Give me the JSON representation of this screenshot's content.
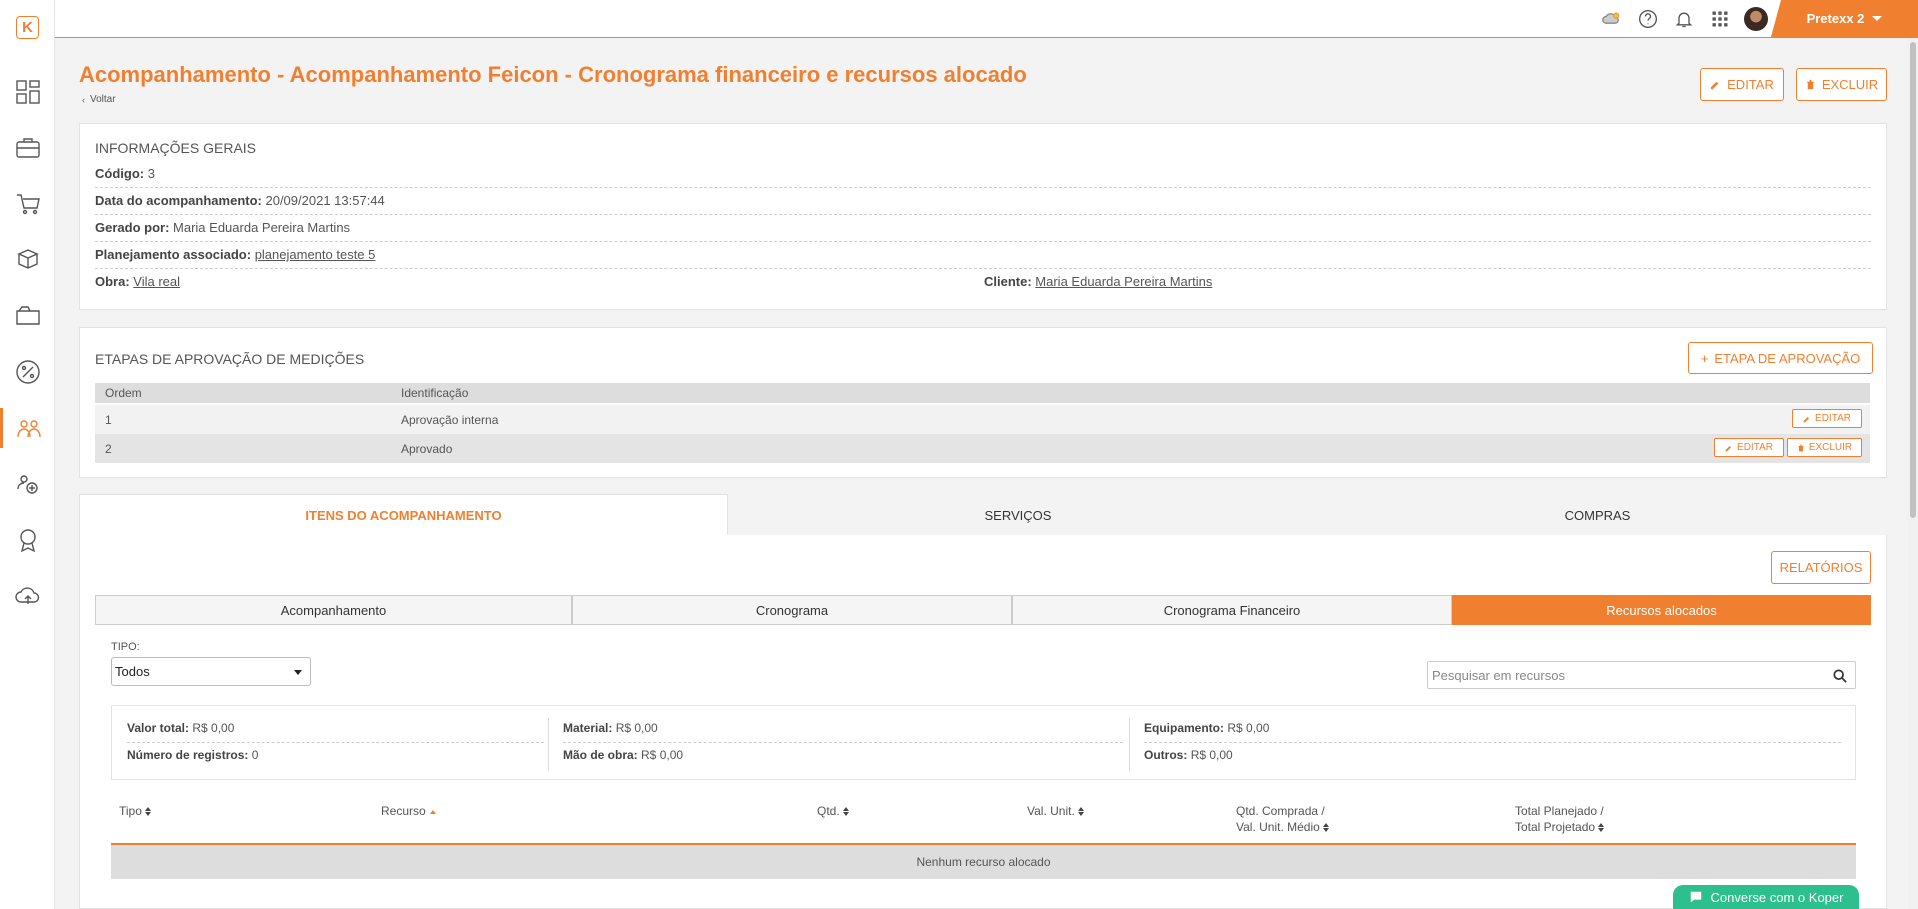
{
  "app": {
    "logo_letter": "K",
    "accent_color": "#f08030"
  },
  "topbar": {
    "user_name": "Pretexx 2"
  },
  "sidebar": {
    "items": [
      {
        "icon": "dashboard-icon"
      },
      {
        "icon": "briefcase-icon"
      },
      {
        "icon": "cart-icon"
      },
      {
        "icon": "boxes-icon"
      },
      {
        "icon": "folder-icon"
      },
      {
        "icon": "percent-icon"
      },
      {
        "icon": "workers-icon",
        "active": true
      },
      {
        "icon": "settings-people-icon"
      },
      {
        "icon": "badge-icon"
      },
      {
        "icon": "cloud-upload-icon"
      }
    ]
  },
  "header": {
    "title": "Acompanhamento - Acompanhamento Feicon - Cronograma financeiro e recursos alocado",
    "back_label": "Voltar",
    "edit_label": "EDITAR",
    "delete_label": "EXCLUIR"
  },
  "info": {
    "section_title": "INFORMAÇÕES GERAIS",
    "code_label": "Código:",
    "code_value": "3",
    "date_label": "Data do acompanhamento:",
    "date_value": "20/09/2021 13:57:44",
    "generated_label": "Gerado por:",
    "generated_value": "Maria Eduarda Pereira Martins",
    "plan_label": "Planejamento associado:",
    "plan_value": "planejamento teste 5",
    "work_label": "Obra:",
    "work_value": "Vila real",
    "client_label": "Cliente:",
    "client_value": "Maria Eduarda Pereira Martins"
  },
  "approval": {
    "section_title": "ETAPAS DE APROVAÇÃO DE MEDIÇÕES",
    "add_button": "ETAPA DE APROVAÇÃO",
    "columns": [
      "Ordem",
      "Identificação"
    ],
    "rows": [
      {
        "order": "1",
        "name": "Aprovação interna",
        "edit": "EDITAR"
      },
      {
        "order": "2",
        "name": "Aprovado",
        "edit": "EDITAR",
        "delete": "EXCLUIR"
      }
    ]
  },
  "tabs": [
    "ITENS DO ACOMPANHAMENTO",
    "SERVIÇOS",
    "COMPRAS"
  ],
  "reports_button": "RELATÓRIOS",
  "subtabs": [
    "Acompanhamento",
    "Cronograma",
    "Cronograma Financeiro",
    "Recursos alocados"
  ],
  "filters": {
    "type_label": "TIPO:",
    "type_value": "Todos",
    "search_placeholder": "Pesquisar em recursos"
  },
  "summary": {
    "total_label": "Valor total:",
    "total_value": "R$ 0,00",
    "records_label": "Número de registros:",
    "records_value": "0",
    "material_label": "Material:",
    "material_value": "R$ 0,00",
    "labor_label": "Mão de obra:",
    "labor_value": "R$ 0,00",
    "equipment_label": "Equipamento:",
    "equipment_value": "R$ 0,00",
    "others_label": "Outros:",
    "others_value": "R$ 0,00"
  },
  "table": {
    "col_type": "Tipo",
    "col_resource": "Recurso",
    "col_qty": "Qtd.",
    "col_unit": "Val. Unit.",
    "col_bought_1": "Qtd. Comprada /",
    "col_bought_2": "Val. Unit. Médio",
    "col_total_1": "Total Planejado /",
    "col_total_2": "Total Projetado",
    "empty_text": "Nenhum recurso alocado"
  },
  "chat": {
    "label": "Converse com o Koper"
  }
}
